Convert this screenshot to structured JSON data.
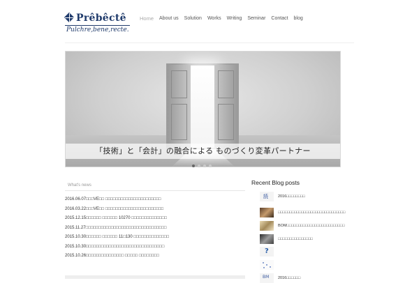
{
  "brand": {
    "name": "Prêbêctê",
    "tagline": "Pulchre,bene,recte."
  },
  "nav": {
    "items": [
      {
        "label": "Home",
        "active": true
      },
      {
        "label": "About us",
        "active": false
      },
      {
        "label": "Solution",
        "active": false
      },
      {
        "label": "Works",
        "active": false
      },
      {
        "label": "Writing",
        "active": false
      },
      {
        "label": "Seminar",
        "active": false
      },
      {
        "label": "Contact",
        "active": false
      },
      {
        "label": "blog",
        "active": false
      }
    ]
  },
  "hero": {
    "caption": "「技術」と「会計」の融合による ものづくり変革パートナー",
    "slide_count": 4,
    "active_slide": 1
  },
  "news": {
    "heading": "What's news",
    "items": [
      "2016.06.07□□□VE□□ □□□□□□□□□□□□□□□□□□□□□□",
      "2016.03.22□□□VE□□ □□□□□□□□□□□□□□□□□□□□□□□",
      "2015.12.15□□□□□□ □□□□□□ 10270 □□□□□□□□□□□□□□",
      "2015.11.27□□□□□□□□□□□□□□□□□□□□□□□□□□□□□□□□",
      "2015.10.30□□□□□□ □□□□□□ 11□130 □□□□□□□□□□□□□□",
      "2015.10.30□□□□□□□□□□□□□□□□□□□□□□□□□□□□□□□",
      "2015.10.26□□□□□□□□□□□□□□□ □□□□□ □□□□□□□□"
    ]
  },
  "blog": {
    "heading": "Recent Blog posts",
    "posts": [
      {
        "title": "2016□□□□□□□□",
        "thumb": "label-thumb"
      },
      {
        "title": "□□□□□□□□□□□□□□□□□□□□□□□□□□□□□",
        "thumb": "photo-thumb"
      },
      {
        "title": "BOM□□□□□□□□□□□□□□□□□□□□□□□□□",
        "thumb": "photo-thumb"
      },
      {
        "title": "□□□□□□□□□□□□□□□",
        "thumb": "photo-thumb"
      },
      {
        "title": "",
        "thumb": "question-thumb"
      },
      {
        "title": "",
        "thumb": "network-thumb"
      },
      {
        "title": "2016□□□□□□",
        "thumb": "label-thumb"
      }
    ]
  },
  "colors": {
    "brand": "#1f3a6b",
    "nav_text": "#555555",
    "nav_active": "#aaaaaa"
  }
}
